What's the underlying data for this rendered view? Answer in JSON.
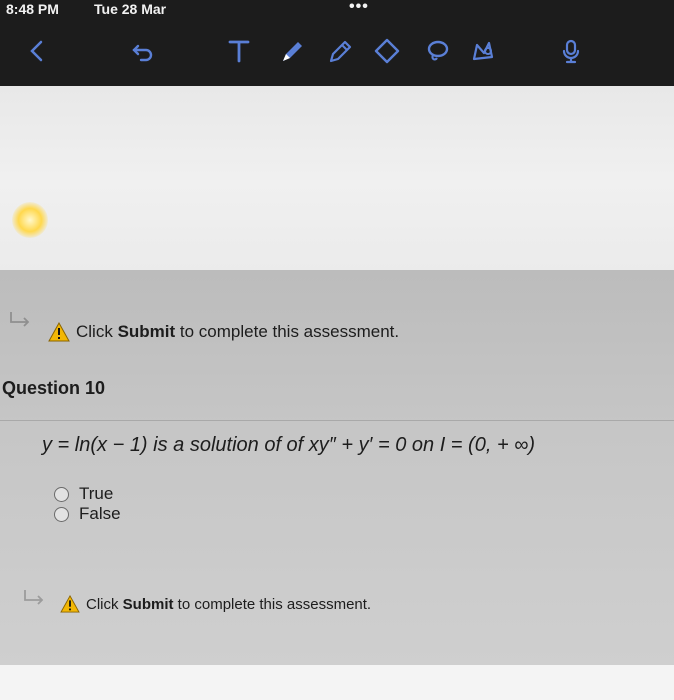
{
  "status": {
    "time": "8:48 PM",
    "date": "Tue 28 Mar",
    "more": "•••"
  },
  "toolbar": {
    "icons": [
      "back-chevron-icon",
      "undo-icon",
      "text-tool-icon",
      "pen-icon",
      "pencil-icon",
      "eraser-icon",
      "lasso-icon",
      "image-icon",
      "microphone-icon"
    ]
  },
  "notice_top": {
    "prefix": "Click ",
    "bold": "Submit",
    "suffix": " to complete this assessment."
  },
  "question": {
    "title": "Question 10",
    "statement": "y = ln(x − 1) is a solution of of xy″ + y′ = 0 on I = (0, + ∞)",
    "options": [
      "True",
      "False"
    ]
  },
  "notice_bottom": {
    "prefix": "Click ",
    "bold": "Submit",
    "suffix": " to complete this assessment."
  }
}
